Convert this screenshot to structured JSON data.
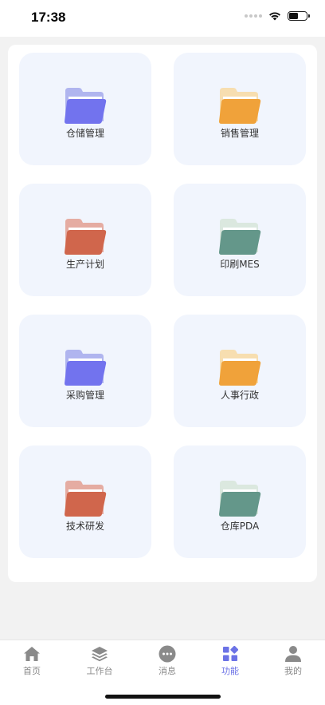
{
  "status_bar": {
    "time": "17:38",
    "icons": [
      "signal-icon",
      "wifi-icon",
      "battery-icon"
    ],
    "battery_level": 0.5
  },
  "grid": {
    "items": [
      {
        "label": "仓储管理",
        "icon": "folder-icon",
        "color_back": "#b0b5ef",
        "color_front": "#7273ee"
      },
      {
        "label": "销售管理",
        "icon": "folder-icon",
        "color_back": "#f7deb0",
        "color_front": "#f0a23a"
      },
      {
        "label": "生产计划",
        "icon": "folder-icon",
        "color_back": "#e5aca2",
        "color_front": "#d0664c"
      },
      {
        "label": "印刷MES",
        "icon": "folder-icon",
        "color_back": "#dbe8df",
        "color_front": "#64978a"
      },
      {
        "label": "采购管理",
        "icon": "folder-icon",
        "color_back": "#b0b5ef",
        "color_front": "#7273ee"
      },
      {
        "label": "人事行政",
        "icon": "folder-icon",
        "color_back": "#f7deb0",
        "color_front": "#f0a23a"
      },
      {
        "label": "技术研发",
        "icon": "folder-icon",
        "color_back": "#e5aca2",
        "color_front": "#d0664c"
      },
      {
        "label": "仓库PDA",
        "icon": "folder-icon",
        "color_back": "#dbe8df",
        "color_front": "#64978a"
      }
    ]
  },
  "tabbar": {
    "active": "功能",
    "accent_color": "#6b72e6",
    "items": [
      {
        "label": "首页",
        "icon": "home-icon"
      },
      {
        "label": "工作台",
        "icon": "layers-icon"
      },
      {
        "label": "消息",
        "icon": "chat-bubble-icon"
      },
      {
        "label": "功能",
        "icon": "grid-apps-icon"
      },
      {
        "label": "我的",
        "icon": "user-icon"
      }
    ]
  }
}
